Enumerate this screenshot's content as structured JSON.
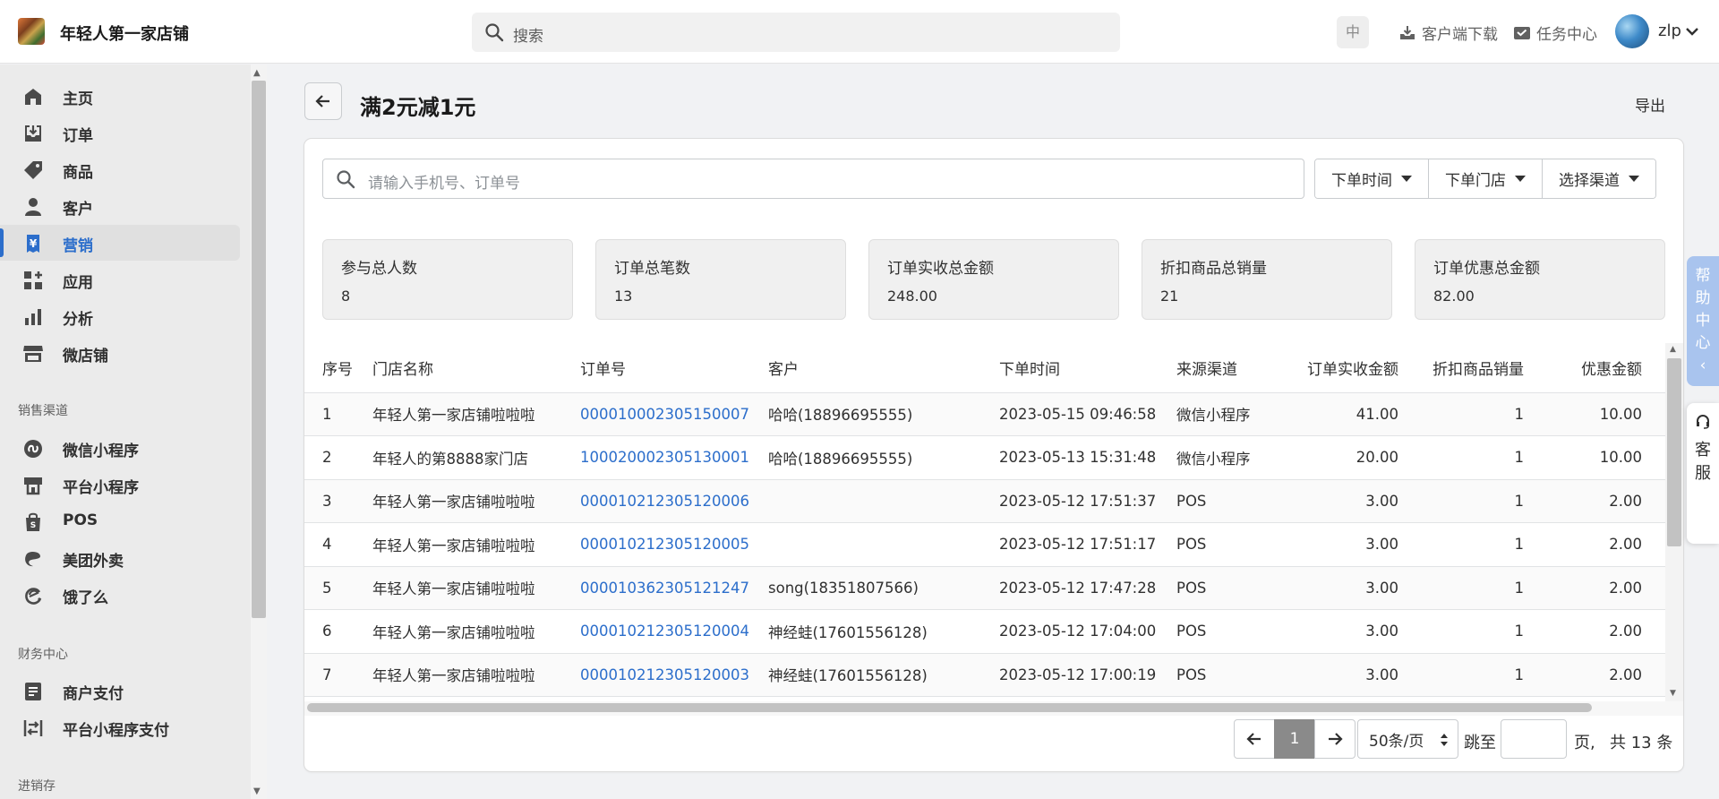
{
  "header": {
    "shop_name": "年轻人第一家店铺",
    "search_placeholder": "搜索",
    "lang": "中",
    "download": "客户端下载",
    "tasks": "任务中心",
    "user": "zlp"
  },
  "sidebar": {
    "items": [
      {
        "label": "主页",
        "icon": "home-icon"
      },
      {
        "label": "订单",
        "icon": "inbox-download-icon"
      },
      {
        "label": "商品",
        "icon": "tag-icon"
      },
      {
        "label": "客户",
        "icon": "person-icon"
      },
      {
        "label": "营销",
        "icon": "yen-icon",
        "active": true
      },
      {
        "label": "应用",
        "icon": "apps-icon"
      },
      {
        "label": "分析",
        "icon": "bar-chart-icon"
      },
      {
        "label": "微店铺",
        "icon": "store-icon"
      }
    ],
    "sales_channels_label": "销售渠道",
    "channels": [
      {
        "label": "微信小程序",
        "icon": "miniprogram-icon"
      },
      {
        "label": "平台小程序",
        "icon": "platform-icon"
      },
      {
        "label": "POS",
        "icon": "shopping-bag-icon"
      },
      {
        "label": "美团外卖",
        "icon": "meituan-icon"
      },
      {
        "label": "饿了么",
        "icon": "eleme-icon"
      }
    ],
    "finance_label": "财务中心",
    "finance": [
      {
        "label": "商户支付",
        "icon": "document-icon"
      },
      {
        "label": "平台小程序支付",
        "icon": "transfer-icon"
      }
    ],
    "inventory_label": "进销存"
  },
  "page": {
    "title": "满2元减1元",
    "export": "导出"
  },
  "filters": {
    "search_placeholder": "请输入手机号、订单号",
    "order_time": "下单时间",
    "order_store": "下单门店",
    "channel": "选择渠道"
  },
  "stats": [
    {
      "label": "参与总人数",
      "value": "8"
    },
    {
      "label": "订单总笔数",
      "value": "13"
    },
    {
      "label": "订单实收总金额",
      "value": "248.00"
    },
    {
      "label": "折扣商品总销量",
      "value": "21"
    },
    {
      "label": "订单优惠总金额",
      "value": "82.00"
    }
  ],
  "table": {
    "columns": [
      "序号",
      "门店名称",
      "订单号",
      "客户",
      "下单时间",
      "来源渠道",
      "订单实收金额",
      "折扣商品销量",
      "优惠金额"
    ],
    "rows": [
      [
        "1",
        "年轻人第一家店铺啦啦啦",
        "000010002305150007",
        "哈哈(18896695555)",
        "2023-05-15 09:46:58",
        "微信小程序",
        "41.00",
        "1",
        "10.00"
      ],
      [
        "2",
        "年轻人的第8888家门店",
        "100020002305130001",
        "哈哈(18896695555)",
        "2023-05-13 15:31:48",
        "微信小程序",
        "20.00",
        "1",
        "10.00"
      ],
      [
        "3",
        "年轻人第一家店铺啦啦啦",
        "000010212305120006",
        "",
        "2023-05-12 17:51:37",
        "POS",
        "3.00",
        "1",
        "2.00"
      ],
      [
        "4",
        "年轻人第一家店铺啦啦啦",
        "000010212305120005",
        "",
        "2023-05-12 17:51:17",
        "POS",
        "3.00",
        "1",
        "2.00"
      ],
      [
        "5",
        "年轻人第一家店铺啦啦啦",
        "000010362305121247",
        "song(18351807566)",
        "2023-05-12 17:47:28",
        "POS",
        "3.00",
        "1",
        "2.00"
      ],
      [
        "6",
        "年轻人第一家店铺啦啦啦",
        "000010212305120004",
        "神经蛙(17601556128)",
        "2023-05-12 17:04:00",
        "POS",
        "3.00",
        "1",
        "2.00"
      ],
      [
        "7",
        "年轻人第一家店铺啦啦啦",
        "000010212305120003",
        "神经蛙(17601556128)",
        "2023-05-12 17:00:19",
        "POS",
        "3.00",
        "1",
        "2.00"
      ]
    ]
  },
  "pagination": {
    "current": "1",
    "page_size": "50条/页",
    "jump_to": "跳至",
    "page_unit": "页,",
    "total": "共 13 条"
  },
  "float": {
    "help": [
      "帮",
      "助",
      "中",
      "心",
      "‹"
    ],
    "service": [
      "客",
      "服"
    ]
  },
  "colors": {
    "accent": "#2c6ecb",
    "help_bg": "#a9c4ee"
  }
}
